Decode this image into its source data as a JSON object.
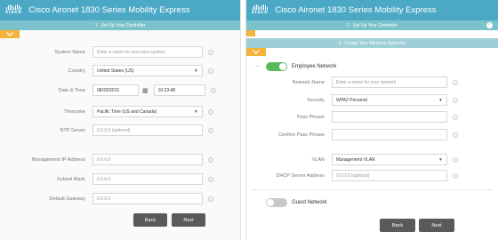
{
  "app": {
    "logo_text": "cisco",
    "title": "Cisco Aironet 1830 Series Mobility Express",
    "colors": {
      "header": "#4ba9c6",
      "step": "#7bc2cb",
      "chevron": "#f2b43a",
      "button": "#5a5a5a",
      "toggle_on": "#5cb85c"
    }
  },
  "left": {
    "step": {
      "num": "1",
      "label": "Set Up Your Controller"
    },
    "fields": {
      "system_name": {
        "label": "System Name",
        "placeholder": "Enter a name for your new system"
      },
      "country": {
        "label": "Country",
        "value": "United States (US)"
      },
      "datetime": {
        "label": "Date & Time",
        "date": "08/20/2015",
        "time": "10:23:48"
      },
      "timezone": {
        "label": "Timezone",
        "value": "Pacific Time (US and Canada)"
      },
      "ntp": {
        "label": "NTP Server",
        "placeholder": "0.0.0.0 (optional)"
      },
      "mgmt_ip": {
        "label": "Management IP Address",
        "placeholder": "0.0.0.0"
      },
      "subnet": {
        "label": "Subnet Mask",
        "placeholder": "0.0.0.0"
      },
      "gateway": {
        "label": "Default Gateway",
        "placeholder": "0.0.0.0"
      }
    },
    "buttons": {
      "back": "Back",
      "next": "Next"
    }
  },
  "right": {
    "step1": {
      "num": "1",
      "label": "Set Up Your Controller"
    },
    "step2": {
      "num": "2",
      "label": "Create Your Wireless Networks"
    },
    "employee": {
      "toggle_label": "Employee Network",
      "network_name": {
        "label": "Network Name",
        "placeholder": "Enter a name for your network"
      },
      "security": {
        "label": "Security",
        "value": "WPA2 Personal"
      },
      "passphrase": {
        "label": "Pass Phrase"
      },
      "confirm": {
        "label": "Confirm Pass Phrase"
      },
      "vlan": {
        "label": "VLAN",
        "value": "Management VLAN"
      },
      "dhcp": {
        "label": "DHCP Server Address",
        "placeholder": "0.0.0.0 (optional)"
      }
    },
    "guest": {
      "toggle_label": "Guest Network"
    },
    "buttons": {
      "back": "Back",
      "next": "Next"
    }
  }
}
